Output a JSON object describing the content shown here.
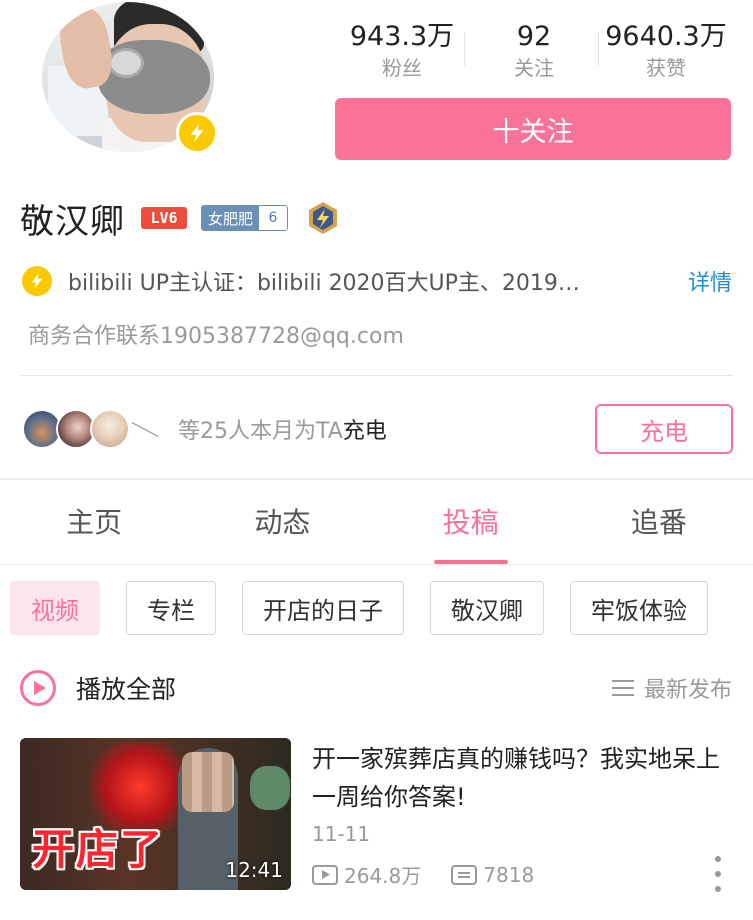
{
  "profile": {
    "username": "敬汉卿",
    "level_badge": "LV6",
    "fan_medal": {
      "name": "女肥肥",
      "level": "6"
    },
    "stats": [
      {
        "value": "943.3万",
        "label": "粉丝"
      },
      {
        "value": "92",
        "label": "关注"
      },
      {
        "value": "9640.3万",
        "label": "获赞"
      }
    ],
    "follow_label": "十关注",
    "certification": "bilibili UP主认证：bilibili 2020百大UP主、2019…",
    "cert_detail_label": "详情",
    "contact": "商务合作联系1905387728@qq.com"
  },
  "charge": {
    "text_prefix": "等25人本月为TA",
    "text_highlight": "充电",
    "button_label": "充电"
  },
  "tabs": [
    {
      "label": "主页",
      "active": false
    },
    {
      "label": "动态",
      "active": false
    },
    {
      "label": "投稿",
      "active": true
    },
    {
      "label": "追番",
      "active": false
    }
  ],
  "chips": [
    {
      "label": "视频",
      "active": true
    },
    {
      "label": "专栏",
      "active": false
    },
    {
      "label": "开店的日子",
      "active": false
    },
    {
      "label": "敬汉卿",
      "active": false
    },
    {
      "label": "牢饭体验",
      "active": false
    }
  ],
  "play_all_label": "播放全部",
  "sort_label": "最新发布",
  "videos": [
    {
      "title": "开一家殡葬店真的赚钱吗？我实地呆上一周给你答案!",
      "thumb_text": "开店了",
      "duration": "12:41",
      "date": "11-11",
      "views": "264.8万",
      "danmaku": "7818"
    }
  ],
  "colors": {
    "accent": "#fb7299",
    "verified": "#fbc900",
    "link": "#1b8fd1",
    "level": "#ee4d3b"
  }
}
